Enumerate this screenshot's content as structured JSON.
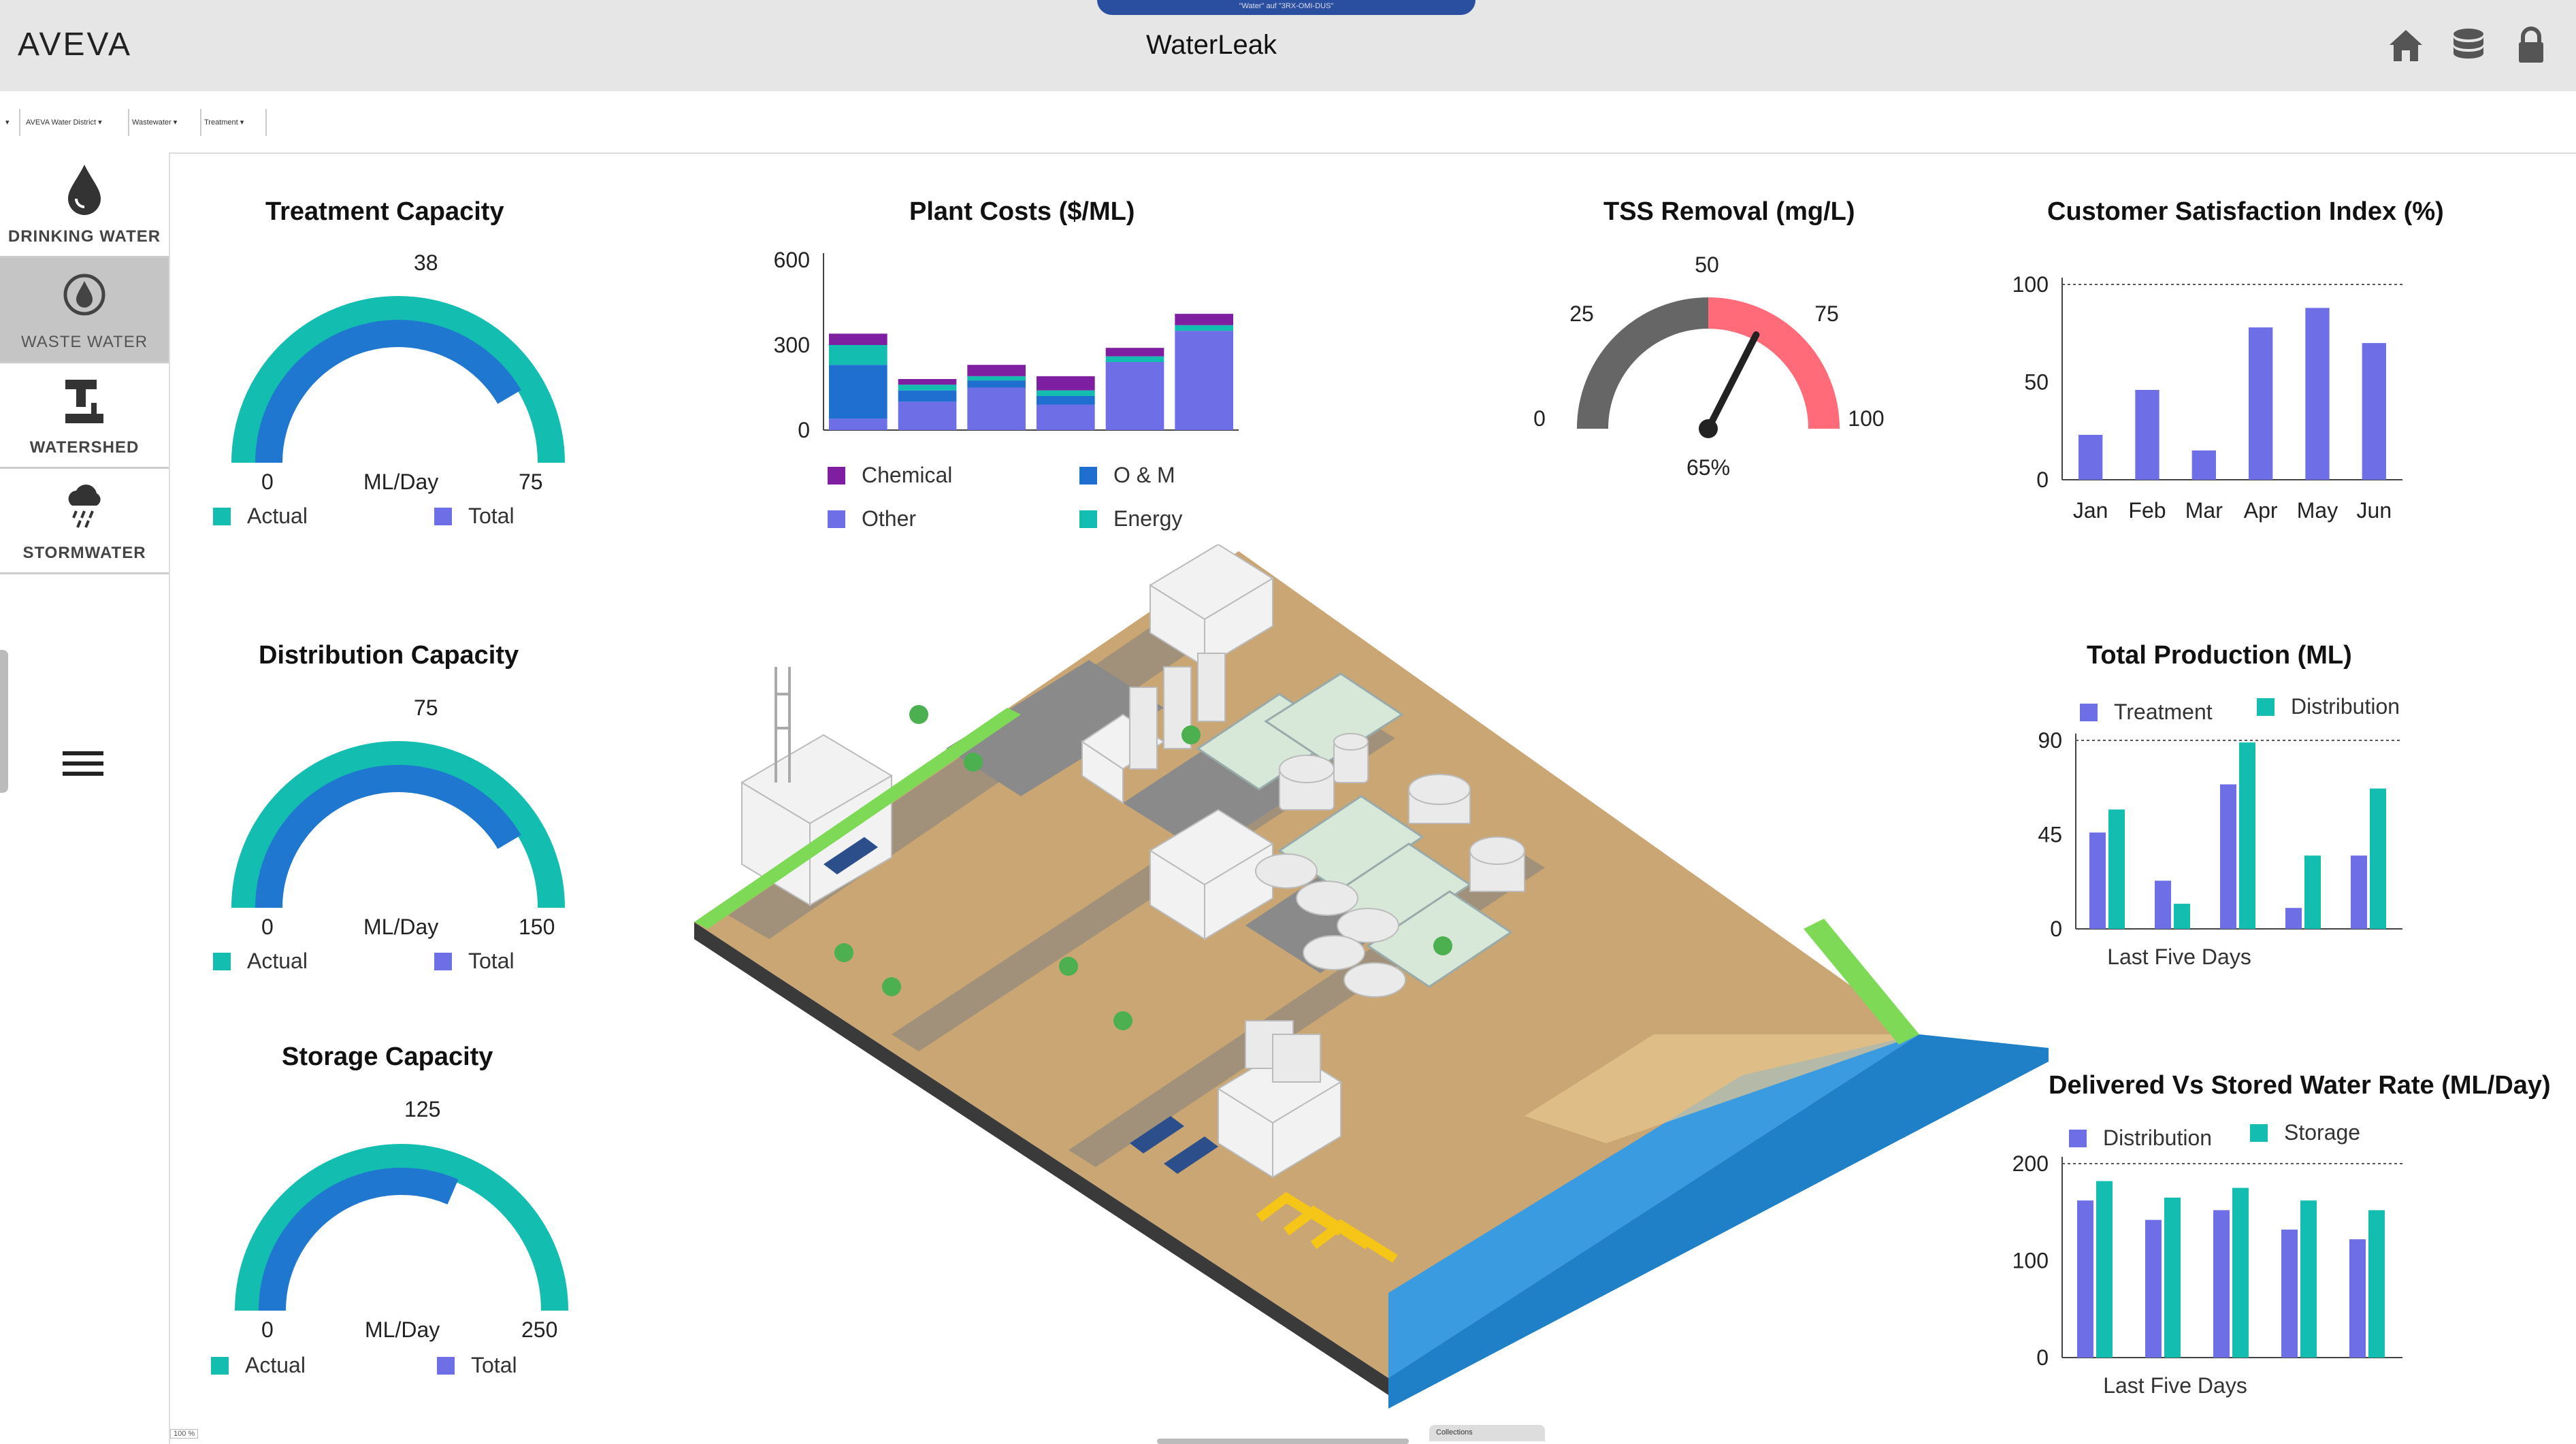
{
  "header": {
    "logo": "AVEVA",
    "title": "WaterLeak",
    "window_caption": "\"Water\" auf \"3RX-OMI-DUS\"",
    "icons": [
      "home-icon",
      "database-icon",
      "lock-icon"
    ]
  },
  "breadcrumb": [
    "AVEVA Water District",
    "Wastewater",
    "Treatment"
  ],
  "sidebar": {
    "items": [
      {
        "label": "DRINKING WATER",
        "icon": "water-drop-icon"
      },
      {
        "label": "WASTE WATER",
        "icon": "waste-water-icon",
        "selected": true
      },
      {
        "label": "WATERSHED",
        "icon": "watershed-icon"
      },
      {
        "label": "STORMWATER",
        "icon": "stormwater-icon"
      }
    ]
  },
  "colors": {
    "actual": "#13bdb0",
    "total": "#1f77d0",
    "purple": "#6e6ee6",
    "teal": "#13bdb0",
    "chemical": "#7d1fa0",
    "om": "#1f6fd0",
    "gauge_red": "#ff6b78",
    "gauge_gray": "#666666"
  },
  "gauges": [
    {
      "title": "Treatment Capacity",
      "value": "38",
      "min": "0",
      "max": "75",
      "unit": "ML/Day",
      "actual_label": "Actual",
      "total_label": "Total",
      "total_frac": 1.0,
      "actual_frac": 0.83
    },
    {
      "title": "Distribution Capacity",
      "value": "75",
      "min": "0",
      "max": "150",
      "unit": "ML/Day",
      "actual_label": "Actual",
      "total_label": "Total",
      "total_frac": 1.0,
      "actual_frac": 0.83
    },
    {
      "title": "Storage Capacity",
      "value": "125",
      "min": "0",
      "max": "250",
      "unit": "ML/Day",
      "actual_label": "Actual",
      "total_label": "Total",
      "total_frac": 1.0,
      "actual_frac": 0.63
    }
  ],
  "tss": {
    "title": "TSS Removal (mg/L)",
    "ticks": [
      "0",
      "25",
      "50",
      "75",
      "100"
    ],
    "value_label": "65%",
    "value": 65
  },
  "chart_data": [
    {
      "type": "bar",
      "title": "Plant Costs ($/ML)",
      "stacked": true,
      "categories": [
        "",
        "",
        "",
        "",
        "",
        ""
      ],
      "ylim": [
        0,
        600
      ],
      "yticks": [
        "600",
        "300",
        "0"
      ],
      "series": [
        {
          "name": "Other",
          "values": [
            40,
            100,
            150,
            90,
            240,
            350
          ]
        },
        {
          "name": "O & M",
          "values": [
            190,
            40,
            25,
            30,
            0,
            0
          ]
        },
        {
          "name": "Energy",
          "values": [
            70,
            20,
            15,
            20,
            20,
            20
          ]
        },
        {
          "name": "Chemical",
          "values": [
            40,
            20,
            40,
            50,
            30,
            40
          ]
        }
      ]
    },
    {
      "type": "bar",
      "title": "Customer Satisfaction Index (%)",
      "categories": [
        "Jan",
        "Feb",
        "Mar",
        "Apr",
        "May",
        "Jun"
      ],
      "ylim": [
        0,
        100
      ],
      "yticks": [
        "100",
        "50",
        "0"
      ],
      "series": [
        {
          "name": "",
          "values": [
            23,
            46,
            15,
            78,
            88,
            70
          ]
        }
      ]
    },
    {
      "type": "bar",
      "title": "Total Production (ML)",
      "xlabel": "Last Five Days",
      "categories": [
        "",
        "",
        "",
        "",
        ""
      ],
      "ylim": [
        0,
        90
      ],
      "yticks": [
        "90",
        "45",
        "0"
      ],
      "series": [
        {
          "name": "Treatment",
          "values": [
            46,
            23,
            69,
            10,
            35
          ]
        },
        {
          "name": "Distribution",
          "values": [
            57,
            12,
            89,
            35,
            67
          ]
        }
      ]
    },
    {
      "type": "bar",
      "title": "Delivered Vs Stored Water Rate (ML/Day)",
      "xlabel": "Last Five Days",
      "categories": [
        "",
        "",
        "",
        "",
        ""
      ],
      "ylim": [
        0,
        200
      ],
      "yticks": [
        "200",
        "100",
        "0"
      ],
      "series": [
        {
          "name": "Distribution",
          "values": [
            162,
            142,
            152,
            132,
            122
          ]
        },
        {
          "name": "Storage",
          "values": [
            182,
            165,
            175,
            162,
            152
          ]
        }
      ]
    }
  ],
  "footer": {
    "zoom": "100 %",
    "collections": "Collections"
  }
}
